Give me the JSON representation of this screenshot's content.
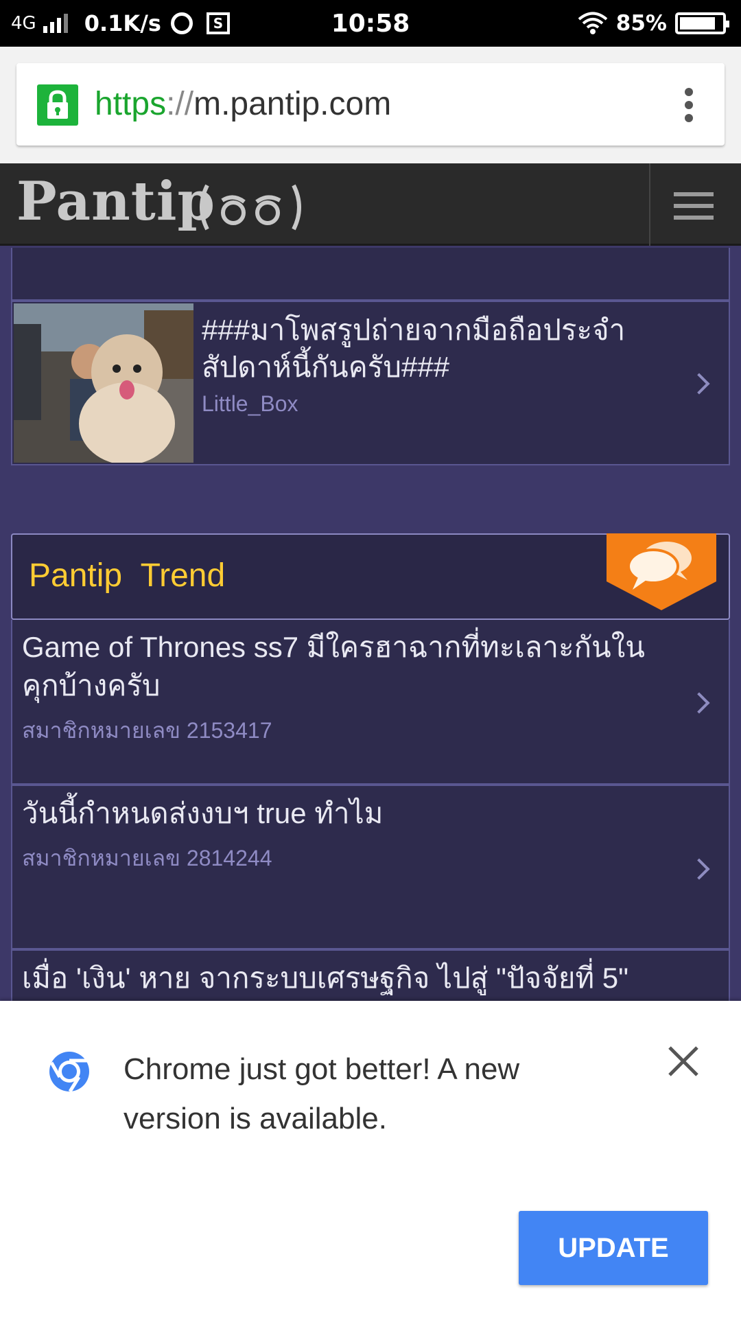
{
  "status_bar": {
    "network": "4G",
    "speed": "0.1K/s",
    "time": "10:58",
    "battery": "85%",
    "battery_level": 0.85,
    "icons": [
      "signal-icon",
      "vpn-icon",
      "screenshot-icon",
      "wifi-icon",
      "battery-icon"
    ]
  },
  "browser": {
    "url_scheme": "https",
    "url_separator": "://",
    "url_host": "m.pantip.com",
    "lock_color": "#1db33b"
  },
  "site": {
    "logo": "Pantip",
    "accent_color": "#ffcc33",
    "badge_color": "#f47f16"
  },
  "photo_post": {
    "title": "###มาโพสรูปถ่ายจากมือถือประจำสัปดาห์นี้กันครับ###",
    "author": "Little_Box"
  },
  "trend": {
    "title": "Pantip  Trend",
    "items": [
      {
        "title": "Game of Thrones ss7 มีใครฮาฉากที่ทะเลาะกันในคุกบ้างครับ",
        "meta": "สมาชิกหมายเลข 2153417"
      },
      {
        "title": "วันนี้กำหนดส่งงบฯ true ทำไม",
        "meta": "สมาชิกหมายเลข 2814244"
      },
      {
        "title": "เมื่อ 'เงิน' หาย จากระบบเศรษฐกิจ ไปสู่ \"ปัจจัยที่ 5\"",
        "meta": ""
      }
    ]
  },
  "update_banner": {
    "message": "Chrome just got better! A new version is available.",
    "button_label": "UPDATE",
    "button_color": "#4285f4"
  }
}
